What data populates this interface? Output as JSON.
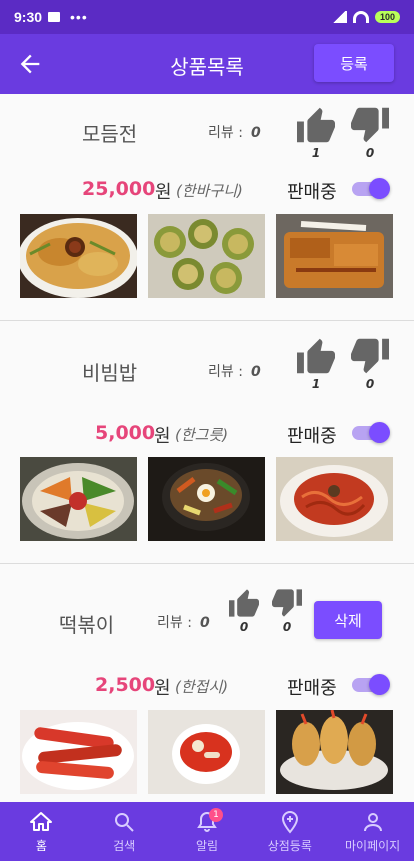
{
  "status": {
    "time": "9:30",
    "battery": "100"
  },
  "appbar": {
    "title": "상품목록",
    "register_label": "등록"
  },
  "products": [
    {
      "name": "모듬전",
      "review_label": "리뷰 :",
      "review_count": "0",
      "likes": "1",
      "dislikes": "0",
      "price": "25,000",
      "currency": "원",
      "unit": "(한바구니)",
      "status": "판매중",
      "action": ""
    },
    {
      "name": "비빔밥",
      "review_label": "리뷰 :",
      "review_count": "0",
      "likes": "1",
      "dislikes": "0",
      "price": "5,000",
      "currency": "원",
      "unit": "(한그릇)",
      "status": "판매중",
      "action": ""
    },
    {
      "name": "떡볶이",
      "review_label": "리뷰 :",
      "review_count": "0",
      "likes": "0",
      "dislikes": "0",
      "price": "2,500",
      "currency": "원",
      "unit": "(한접시)",
      "status": "판매중",
      "action": "삭제"
    }
  ],
  "nav": [
    {
      "label": "홈",
      "icon": "home-icon",
      "active": true
    },
    {
      "label": "검색",
      "icon": "search-icon"
    },
    {
      "label": "알림",
      "icon": "bell-icon",
      "badge": "1"
    },
    {
      "label": "상점등록",
      "icon": "location-plus-icon"
    },
    {
      "label": "마이페이지",
      "icon": "person-icon"
    }
  ],
  "colors": {
    "primary": "#6a3be0",
    "accent": "#7b4dff",
    "price": "#e6457a"
  }
}
